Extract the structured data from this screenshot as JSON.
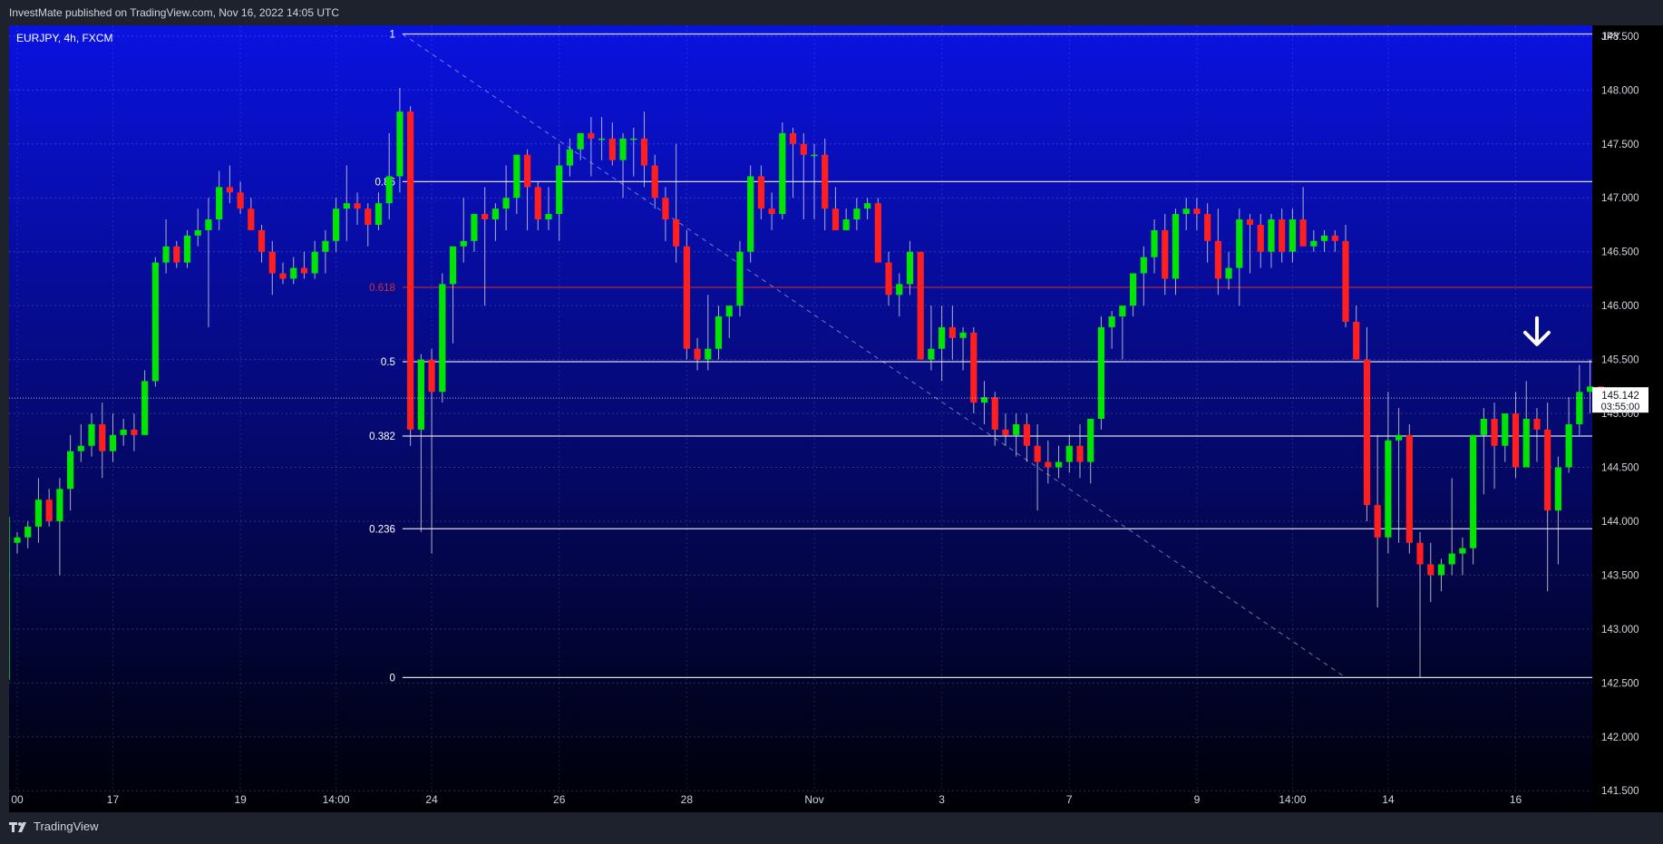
{
  "header": {
    "published": "InvestMate published on TradingView.com, Nov 16, 2022 14:05 UTC"
  },
  "symbol": {
    "label": "EURJPY, 4h, FXCM"
  },
  "footer": {
    "logo_text": "TradingView",
    "logo_icon": "tradingview-logo-icon"
  },
  "colors": {
    "up": "#00e600",
    "down": "#ff1f1f",
    "fib_line": "#ffffff",
    "fib_618": "#d62f2f",
    "bg_top": "#0a12e0",
    "bg_bottom": "#000005"
  },
  "chart_data": {
    "type": "candlestick",
    "symbol": "EURJPY",
    "timeframe": "4h",
    "currency": "JPY",
    "ylim": [
      141.3,
      148.6
    ],
    "y_ticks": [
      {
        "value": 148.5,
        "label": "148.500"
      },
      {
        "value": 148.0,
        "label": "148.000"
      },
      {
        "value": 147.5,
        "label": "147.500"
      },
      {
        "value": 147.0,
        "label": "147.000"
      },
      {
        "value": 146.5,
        "label": "146.500"
      },
      {
        "value": 146.0,
        "label": "146.000"
      },
      {
        "value": 145.5,
        "label": "145.500"
      },
      {
        "value": 145.0,
        "label": "145.000"
      },
      {
        "value": 144.5,
        "label": "144.500"
      },
      {
        "value": 144.0,
        "label": "144.000"
      },
      {
        "value": 143.5,
        "label": "143.500"
      },
      {
        "value": 143.0,
        "label": "143.000"
      },
      {
        "value": 142.5,
        "label": "142.500"
      },
      {
        "value": 142.0,
        "label": "142.000"
      },
      {
        "value": 141.5,
        "label": "141.500"
      }
    ],
    "x_ticks": [
      {
        "i": 0,
        "label": "00"
      },
      {
        "i": 9,
        "label": "17"
      },
      {
        "i": 21,
        "label": "19"
      },
      {
        "i": 30,
        "label": "14:00"
      },
      {
        "i": 39,
        "label": "24"
      },
      {
        "i": 51,
        "label": "26"
      },
      {
        "i": 63,
        "label": "28"
      },
      {
        "i": 75,
        "label": "Nov"
      },
      {
        "i": 87,
        "label": "3"
      },
      {
        "i": 99,
        "label": "7"
      },
      {
        "i": 111,
        "label": "9"
      },
      {
        "i": 120,
        "label": "14:00"
      },
      {
        "i": 129,
        "label": "14"
      },
      {
        "i": 141,
        "label": "16"
      }
    ],
    "last_price": {
      "value": 145.142,
      "label": "145.142",
      "countdown": "03:55:00"
    },
    "fib_levels": [
      {
        "level": "1",
        "price": 148.52
      },
      {
        "level": "0.786",
        "label": "0.86",
        "price": 147.15
      },
      {
        "level": "0.618",
        "price": 146.17,
        "highlight": true
      },
      {
        "level": "0.5",
        "price": 145.48
      },
      {
        "level": "0.382",
        "price": 144.79
      },
      {
        "level": "0.236",
        "price": 143.93
      },
      {
        "level": "0",
        "price": 142.55
      }
    ],
    "fib_trend": {
      "start": {
        "i": 36,
        "price": 148.52
      },
      "end": {
        "i": 125,
        "price": 142.55
      }
    },
    "arrow": {
      "i": 143,
      "price": 145.75,
      "icon": "arrow-down-icon"
    },
    "candles": [
      [
        143.8,
        143.9,
        143.7,
        143.85
      ],
      [
        143.85,
        144.0,
        143.75,
        143.95
      ],
      [
        143.95,
        144.4,
        143.8,
        144.2
      ],
      [
        144.2,
        144.3,
        143.95,
        144.0
      ],
      [
        144.0,
        144.4,
        143.5,
        144.3
      ],
      [
        144.3,
        144.8,
        144.1,
        144.65
      ],
      [
        144.65,
        144.9,
        144.55,
        144.7
      ],
      [
        144.7,
        145.0,
        144.6,
        144.9
      ],
      [
        144.9,
        145.1,
        144.4,
        144.65
      ],
      [
        144.65,
        145.0,
        144.55,
        144.8
      ],
      [
        144.8,
        144.95,
        144.7,
        144.85
      ],
      [
        144.85,
        145.0,
        144.65,
        144.8
      ],
      [
        144.8,
        145.4,
        144.8,
        145.3
      ],
      [
        145.3,
        146.45,
        145.25,
        146.4
      ],
      [
        146.4,
        146.8,
        146.3,
        146.55
      ],
      [
        146.55,
        146.6,
        146.35,
        146.4
      ],
      [
        146.4,
        146.7,
        146.35,
        146.65
      ],
      [
        146.65,
        146.9,
        146.55,
        146.7
      ],
      [
        146.7,
        147.0,
        145.8,
        146.8
      ],
      [
        146.8,
        147.25,
        146.7,
        147.1
      ],
      [
        147.1,
        147.3,
        146.95,
        147.05
      ],
      [
        147.05,
        147.15,
        146.85,
        146.9
      ],
      [
        146.9,
        147.0,
        146.7,
        146.7
      ],
      [
        146.7,
        146.75,
        146.4,
        146.5
      ],
      [
        146.5,
        146.6,
        146.1,
        146.3
      ],
      [
        146.3,
        146.4,
        146.2,
        146.25
      ],
      [
        146.25,
        146.45,
        146.2,
        146.35
      ],
      [
        146.35,
        146.5,
        146.25,
        146.3
      ],
      [
        146.3,
        146.6,
        146.25,
        146.5
      ],
      [
        146.5,
        146.7,
        146.3,
        146.6
      ],
      [
        146.6,
        147.0,
        146.5,
        146.9
      ],
      [
        146.9,
        147.3,
        146.6,
        146.95
      ],
      [
        146.95,
        147.05,
        146.75,
        146.9
      ],
      [
        146.9,
        146.95,
        146.55,
        146.75
      ],
      [
        146.75,
        147.05,
        146.7,
        146.95
      ],
      [
        146.95,
        147.6,
        146.8,
        147.2
      ],
      [
        147.2,
        148.02,
        147.05,
        147.8
      ],
      [
        147.8,
        147.85,
        144.7,
        144.85
      ],
      [
        144.85,
        145.55,
        143.9,
        145.5
      ],
      [
        145.5,
        145.6,
        143.7,
        145.2
      ],
      [
        145.2,
        146.3,
        145.1,
        146.2
      ],
      [
        146.2,
        146.5,
        145.65,
        146.55
      ],
      [
        146.55,
        147.0,
        146.4,
        146.6
      ],
      [
        146.6,
        146.85,
        146.5,
        146.85
      ],
      [
        146.85,
        147.1,
        146.0,
        146.8
      ],
      [
        146.8,
        146.95,
        146.6,
        146.9
      ],
      [
        146.9,
        147.3,
        146.7,
        147.0
      ],
      [
        147.0,
        147.4,
        146.85,
        147.4
      ],
      [
        147.4,
        147.45,
        146.7,
        147.1
      ],
      [
        147.1,
        147.15,
        146.7,
        146.8
      ],
      [
        146.8,
        147.1,
        146.7,
        146.85
      ],
      [
        146.85,
        147.5,
        146.6,
        147.3
      ],
      [
        147.3,
        147.55,
        147.2,
        147.45
      ],
      [
        147.45,
        147.6,
        147.35,
        147.6
      ],
      [
        147.6,
        147.75,
        147.2,
        147.55
      ],
      [
        147.55,
        147.75,
        147.35,
        147.55
      ],
      [
        147.55,
        147.7,
        147.3,
        147.35
      ],
      [
        147.35,
        147.6,
        147.0,
        147.55
      ],
      [
        147.55,
        147.65,
        147.2,
        147.55
      ],
      [
        147.55,
        147.8,
        147.1,
        147.3
      ],
      [
        147.3,
        147.4,
        146.9,
        147.0
      ],
      [
        147.0,
        147.1,
        146.6,
        146.8
      ],
      [
        146.8,
        147.5,
        146.4,
        146.55
      ],
      [
        146.55,
        146.7,
        145.5,
        145.6
      ],
      [
        145.6,
        145.7,
        145.4,
        145.5
      ],
      [
        145.5,
        146.1,
        145.4,
        145.6
      ],
      [
        145.6,
        146.0,
        145.5,
        145.9
      ],
      [
        145.9,
        146.0,
        145.7,
        146.0
      ],
      [
        146.0,
        146.6,
        145.9,
        146.5
      ],
      [
        146.5,
        147.3,
        146.4,
        147.2
      ],
      [
        147.2,
        147.3,
        146.8,
        146.9
      ],
      [
        146.9,
        147.05,
        146.7,
        146.85
      ],
      [
        146.85,
        147.7,
        146.8,
        147.6
      ],
      [
        147.6,
        147.65,
        147.0,
        147.5
      ],
      [
        147.5,
        147.6,
        146.8,
        147.4
      ],
      [
        147.4,
        147.5,
        146.8,
        147.4
      ],
      [
        147.4,
        147.55,
        146.7,
        146.9
      ],
      [
        146.9,
        147.1,
        146.7,
        146.7
      ],
      [
        146.7,
        146.9,
        146.7,
        146.8
      ],
      [
        146.8,
        147.0,
        146.7,
        146.9
      ],
      [
        146.9,
        147.0,
        146.8,
        146.95
      ],
      [
        146.95,
        147.0,
        146.5,
        146.4
      ],
      [
        146.4,
        146.5,
        146.0,
        146.1
      ],
      [
        146.1,
        146.3,
        145.9,
        146.2
      ],
      [
        146.2,
        146.6,
        146.1,
        146.5
      ],
      [
        146.5,
        146.5,
        145.6,
        145.5
      ],
      [
        145.5,
        146.0,
        145.4,
        145.6
      ],
      [
        145.6,
        146.0,
        145.3,
        145.8
      ],
      [
        145.8,
        146.0,
        145.5,
        145.7
      ],
      [
        145.7,
        145.8,
        145.4,
        145.75
      ],
      [
        145.75,
        145.8,
        145.0,
        145.1
      ],
      [
        145.1,
        145.3,
        144.9,
        145.15
      ],
      [
        145.15,
        145.2,
        144.7,
        144.85
      ],
      [
        144.85,
        145.0,
        144.7,
        144.8
      ],
      [
        144.8,
        145.0,
        144.6,
        144.9
      ],
      [
        144.9,
        145.0,
        144.55,
        144.7
      ],
      [
        144.7,
        144.9,
        144.1,
        144.55
      ],
      [
        144.55,
        144.75,
        144.35,
        144.5
      ],
      [
        144.5,
        144.7,
        144.4,
        144.55
      ],
      [
        144.55,
        144.8,
        144.45,
        144.7
      ],
      [
        144.7,
        144.9,
        144.4,
        144.55
      ],
      [
        144.55,
        144.8,
        144.35,
        144.95
      ],
      [
        144.95,
        145.9,
        144.85,
        145.8
      ],
      [
        145.8,
        145.95,
        145.6,
        145.9
      ],
      [
        145.9,
        146.0,
        145.5,
        146.0
      ],
      [
        146.0,
        146.3,
        145.9,
        146.3
      ],
      [
        146.3,
        146.55,
        146.0,
        146.45
      ],
      [
        146.45,
        146.8,
        146.3,
        146.7
      ],
      [
        146.7,
        146.85,
        146.1,
        146.25
      ],
      [
        146.25,
        146.9,
        146.1,
        146.85
      ],
      [
        146.85,
        147.0,
        146.7,
        146.9
      ],
      [
        146.9,
        147.0,
        146.7,
        146.85
      ],
      [
        146.85,
        146.95,
        146.4,
        146.6
      ],
      [
        146.6,
        146.9,
        146.1,
        146.25
      ],
      [
        146.25,
        146.5,
        146.15,
        146.35
      ],
      [
        146.35,
        146.9,
        146.0,
        146.8
      ],
      [
        146.8,
        146.85,
        146.3,
        146.75
      ],
      [
        146.75,
        146.85,
        146.35,
        146.5
      ],
      [
        146.5,
        146.85,
        146.35,
        146.8
      ],
      [
        146.8,
        146.9,
        146.4,
        146.5
      ],
      [
        146.5,
        146.9,
        146.4,
        146.8
      ],
      [
        146.8,
        147.1,
        146.6,
        146.55
      ],
      [
        146.55,
        146.7,
        146.5,
        146.6
      ],
      [
        146.6,
        146.7,
        146.5,
        146.65
      ],
      [
        146.65,
        146.7,
        146.5,
        146.6
      ],
      [
        146.6,
        146.75,
        145.8,
        145.85
      ],
      [
        145.85,
        146.0,
        145.5,
        145.5
      ],
      [
        145.5,
        145.8,
        144.0,
        144.15
      ],
      [
        144.15,
        144.8,
        143.2,
        143.85
      ],
      [
        143.85,
        145.2,
        143.7,
        144.75
      ],
      [
        144.75,
        145.05,
        143.8,
        144.8
      ],
      [
        144.8,
        144.9,
        143.7,
        143.8
      ],
      [
        143.8,
        143.9,
        142.55,
        143.6
      ],
      [
        143.6,
        143.8,
        143.25,
        143.5
      ],
      [
        143.5,
        143.65,
        143.35,
        143.6
      ],
      [
        143.6,
        144.4,
        143.5,
        143.7
      ],
      [
        143.7,
        143.85,
        143.5,
        143.75
      ],
      [
        143.75,
        144.8,
        143.6,
        144.8
      ],
      [
        144.8,
        145.05,
        144.25,
        144.95
      ],
      [
        144.95,
        145.1,
        144.3,
        144.7
      ],
      [
        144.7,
        145.0,
        144.55,
        145.0
      ],
      [
        145.0,
        145.2,
        144.4,
        144.5
      ],
      [
        144.5,
        145.3,
        144.5,
        144.95
      ],
      [
        144.95,
        145.05,
        144.55,
        144.85
      ],
      [
        144.85,
        145.1,
        143.35,
        144.1
      ],
      [
        144.1,
        144.6,
        143.6,
        144.5
      ],
      [
        144.5,
        145.15,
        144.45,
        144.9
      ],
      [
        144.9,
        145.45,
        144.8,
        145.2
      ],
      [
        145.2,
        145.5,
        145.0,
        145.25
      ],
      [
        145.25,
        145.25,
        145.1,
        145.14
      ]
    ]
  }
}
